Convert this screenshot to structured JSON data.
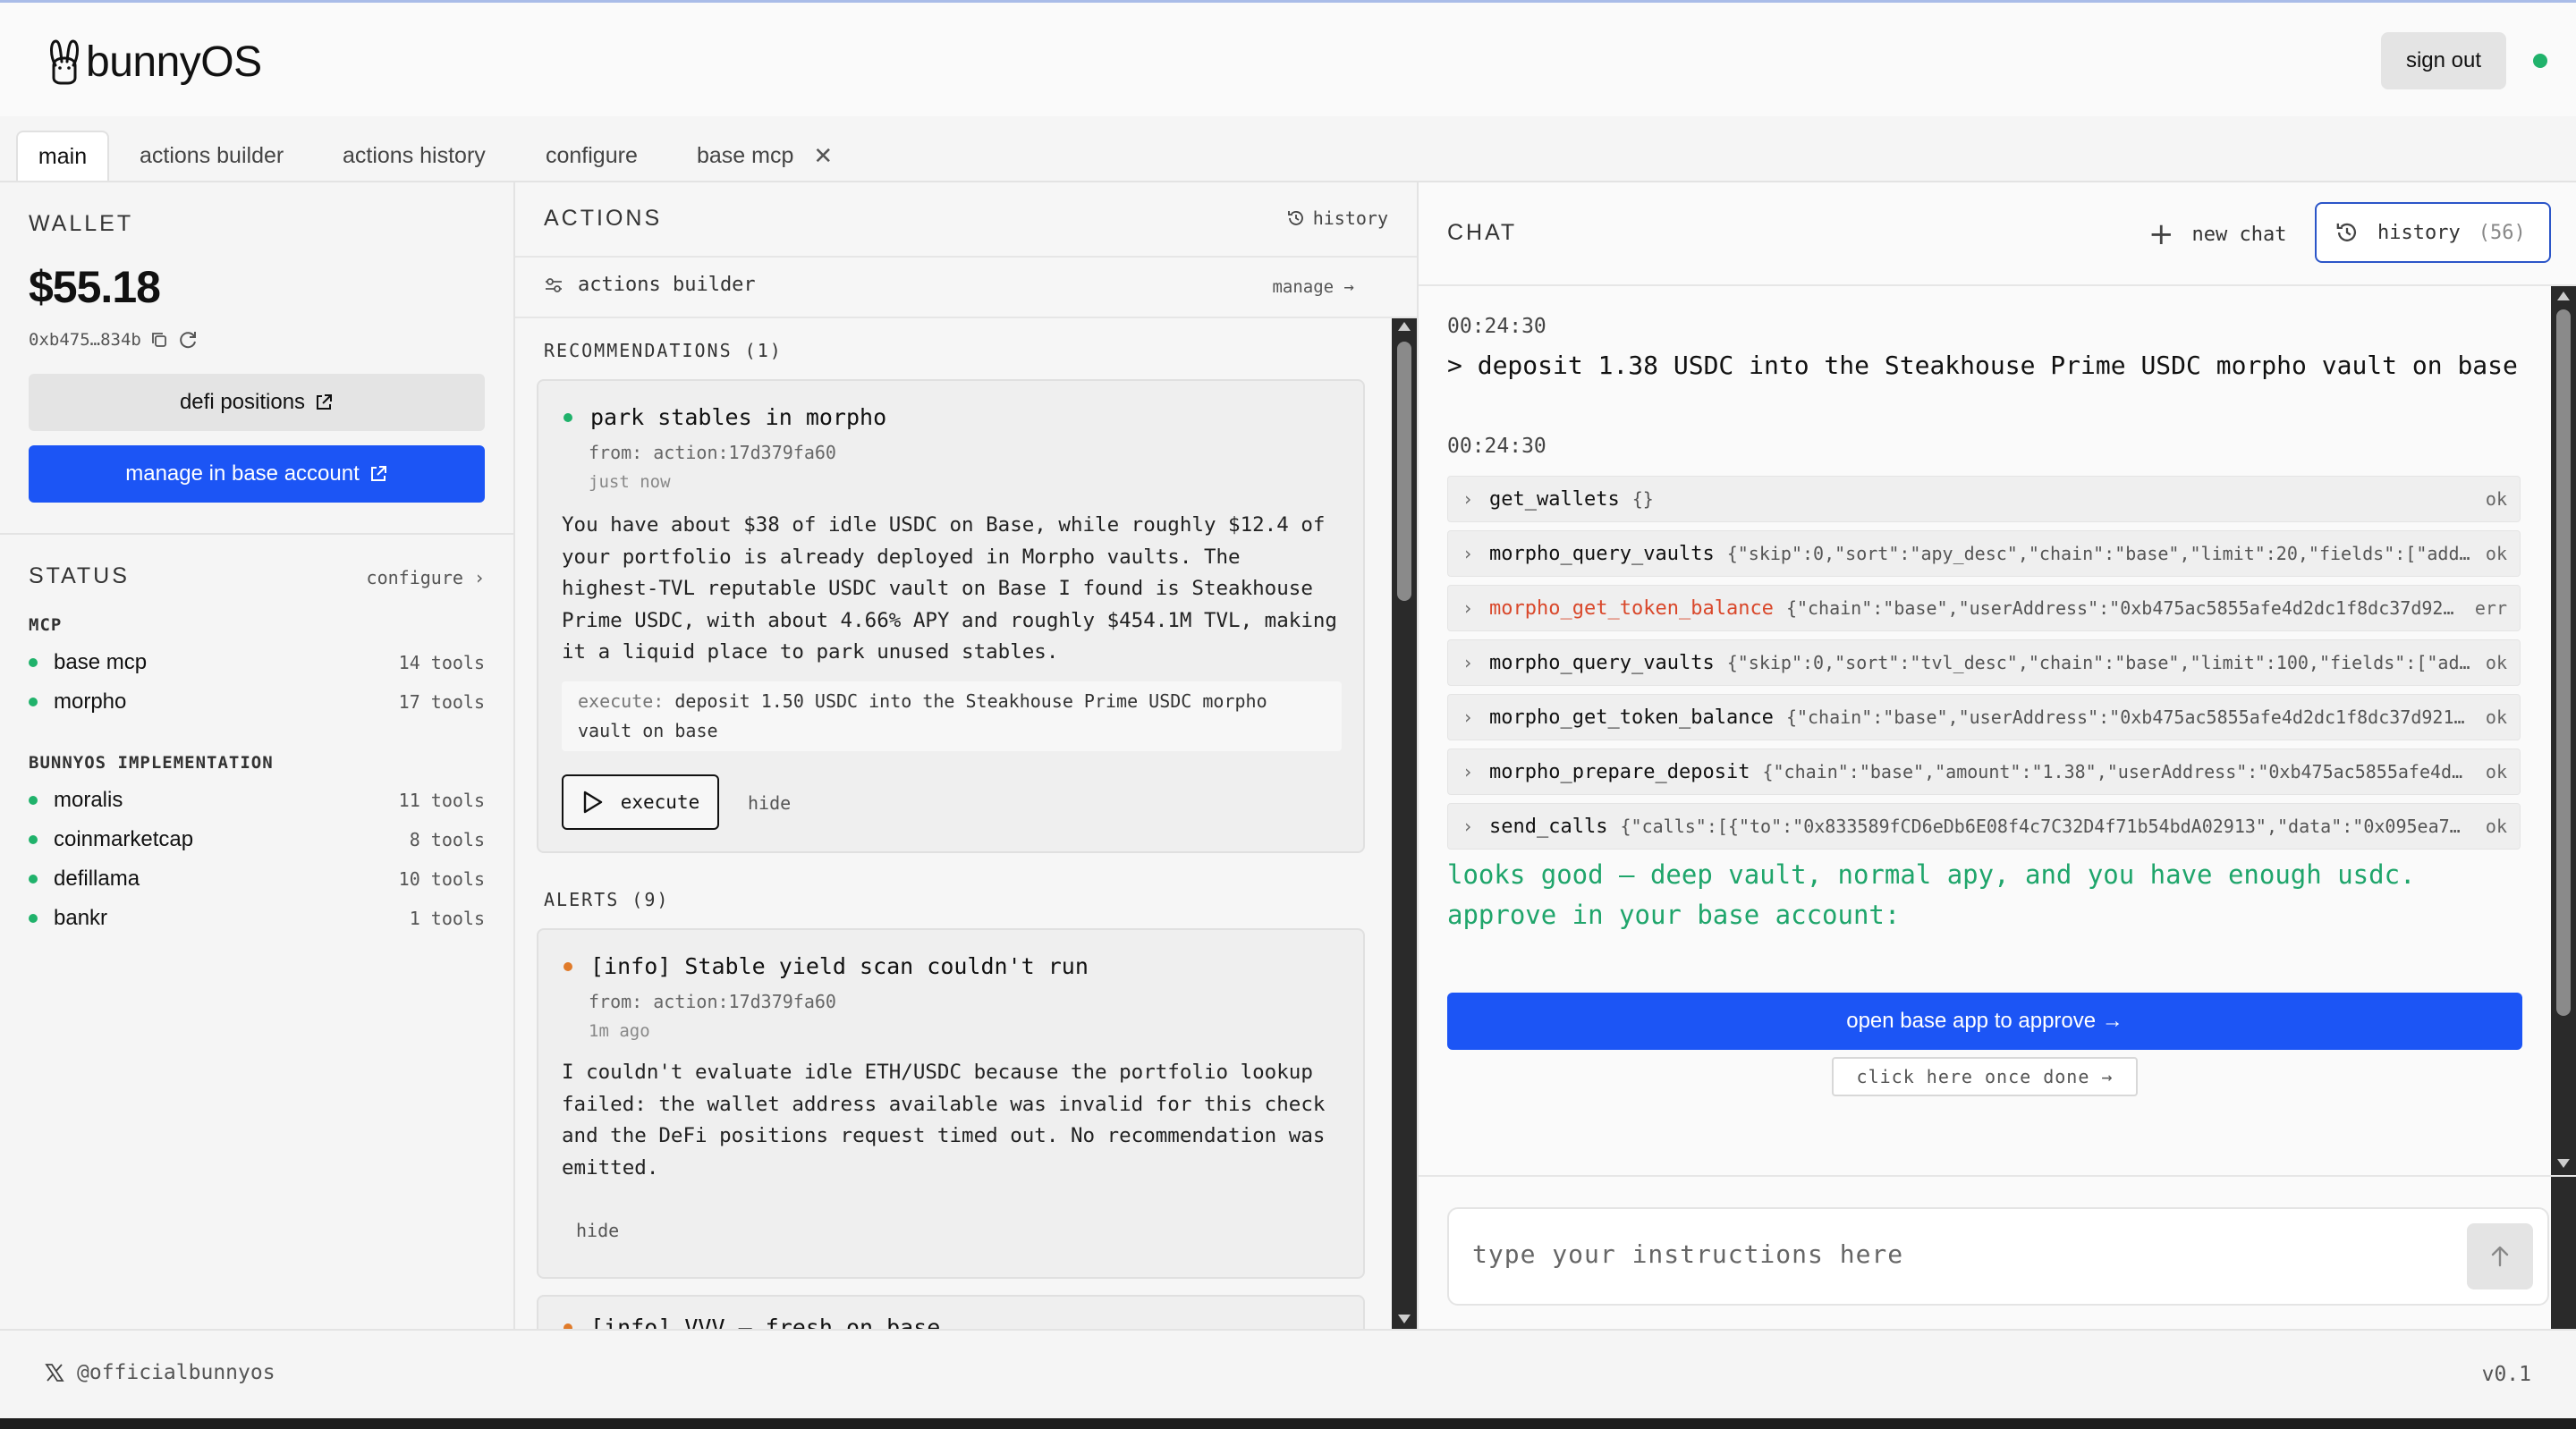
{
  "app": {
    "name": "bunnyOS",
    "sign_out": "sign out",
    "status_color": "#20b26b"
  },
  "tabs": [
    {
      "label": "main",
      "active": true
    },
    {
      "label": "actions builder"
    },
    {
      "label": "actions history"
    },
    {
      "label": "configure"
    },
    {
      "label": "base mcp",
      "closable": true
    }
  ],
  "wallet": {
    "title": "WALLET",
    "balance": "$55.18",
    "address": "0xb475…834b",
    "defi_button": "defi positions",
    "manage_button": "manage in base account"
  },
  "status": {
    "title": "STATUS",
    "configure": "configure ›",
    "mcp_title": "MCP",
    "mcp": [
      {
        "name": "base mcp",
        "count": "14 tools"
      },
      {
        "name": "morpho",
        "count": "17 tools"
      }
    ],
    "impl_title": "BUNNYOS IMPLEMENTATION",
    "impl": [
      {
        "name": "moralis",
        "count": "11 tools"
      },
      {
        "name": "coinmarketcap",
        "count": "8 tools"
      },
      {
        "name": "defillama",
        "count": "10 tools"
      },
      {
        "name": "bankr",
        "count": "1 tools"
      }
    ]
  },
  "actions": {
    "title": "ACTIONS",
    "history": "history",
    "builder_label": "actions builder",
    "manage": "manage →",
    "recommendations_title": "RECOMMENDATIONS (1)",
    "recommendation": {
      "title": "park stables in morpho",
      "from": "from: action:17d379fa60",
      "time": "just now",
      "body": "You have about $38 of idle USDC on Base, while roughly $12.4 of your portfolio is already deployed in Morpho vaults. The highest-TVL reputable USDC vault on Base I found is Steakhouse Prime USDC, with about 4.66% APY and roughly $454.1M TVL, making it a liquid place to park unused stables.",
      "execute_prefix": "execute:",
      "execute_text": "deposit 1.50 USDC into the Steakhouse Prime USDC morpho vault on base",
      "execute_button": "execute",
      "hide": "hide",
      "bullet_color": "#20b26b"
    },
    "alerts_title": "ALERTS (9)",
    "alert": {
      "title": "[info] Stable yield scan couldn't run",
      "from": "from: action:17d379fa60",
      "time": "1m ago",
      "body": "I couldn't evaluate idle ETH/USDC because the portfolio lookup failed: the wallet address available was invalid for this check and the DeFi positions request timed out. No recommendation was emitted.",
      "hide": "hide",
      "bullet_color": "#e07b2a"
    },
    "alert2_title": "[info] VVV — fresh on base"
  },
  "chat": {
    "title": "CHAT",
    "new_chat": "new chat",
    "history_label": "history",
    "history_count": "(56)",
    "ts1": "00:24:30",
    "user_message": "> deposit 1.38 USDC into the Steakhouse Prime USDC morpho vault on base",
    "ts2": "00:24:30",
    "calls": [
      {
        "name": "get_wallets",
        "args": "{}",
        "status": "ok"
      },
      {
        "name": "morpho_query_vaults",
        "args": "{\"skip\":0,\"sort\":\"apy_desc\",\"chain\":\"base\",\"limit\":20,\"fields\":[\"add…",
        "status": "ok"
      },
      {
        "name": "morpho_get_token_balance",
        "args": "{\"chain\":\"base\",\"userAddress\":\"0xb475ac5855afe4d2dc1f8dc37d92…",
        "status": "err"
      },
      {
        "name": "morpho_query_vaults",
        "args": "{\"skip\":0,\"sort\":\"tvl_desc\",\"chain\":\"base\",\"limit\":100,\"fields\":[\"ad…",
        "status": "ok"
      },
      {
        "name": "morpho_get_token_balance",
        "args": "{\"chain\":\"base\",\"userAddress\":\"0xb475ac5855afe4d2dc1f8dc37d921…",
        "status": "ok"
      },
      {
        "name": "morpho_prepare_deposit",
        "args": "{\"chain\":\"base\",\"amount\":\"1.38\",\"userAddress\":\"0xb475ac5855afe4d…",
        "status": "ok"
      },
      {
        "name": "send_calls",
        "args": "{\"calls\":[{\"to\":\"0x833589fCD6eDb6E08f4c7C32D4f71b54bdA02913\",\"data\":\"0x095ea7…",
        "status": "ok"
      }
    ],
    "reply": "looks good — deep vault, normal apy, and you have enough usdc. approve in your base account:",
    "approve_button": "open base app to approve →",
    "done_button": "click here once done →",
    "input_placeholder": "type your instructions here",
    "accent": "#1c55f5",
    "reply_color": "#1fa56b",
    "error_color": "#d9482b"
  },
  "footer": {
    "handle": "@officialbunnyos",
    "version": "v0.1"
  }
}
